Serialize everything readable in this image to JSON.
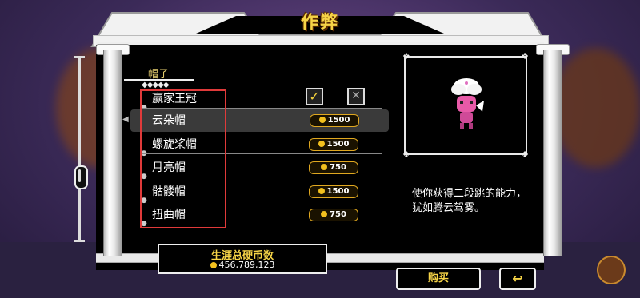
{
  "title": "作弊",
  "category": "帽子",
  "checkboxes": {
    "enabled": "✓",
    "disabled": "✕"
  },
  "items": [
    {
      "name": "赢家王冠",
      "price": ""
    },
    {
      "name": "云朵帽",
      "price": "1500",
      "selected": true
    },
    {
      "name": "螺旋桨帽",
      "price": "1500"
    },
    {
      "name": "月亮帽",
      "price": "750"
    },
    {
      "name": "骷髅帽",
      "price": "1500"
    },
    {
      "name": "扭曲帽",
      "price": "750"
    }
  ],
  "description": "使你获得二段跳的能力，犹如腾云驾雾。",
  "career_coins": {
    "label": "生涯总硬币数",
    "value": "456,789,123"
  },
  "buttons": {
    "buy": "购买",
    "back": "↩"
  },
  "colors": {
    "gold": "#f6d447",
    "annotation": "#e03a3a"
  },
  "icons": {
    "coin": "coin-icon",
    "back": "return-arrow-icon"
  }
}
